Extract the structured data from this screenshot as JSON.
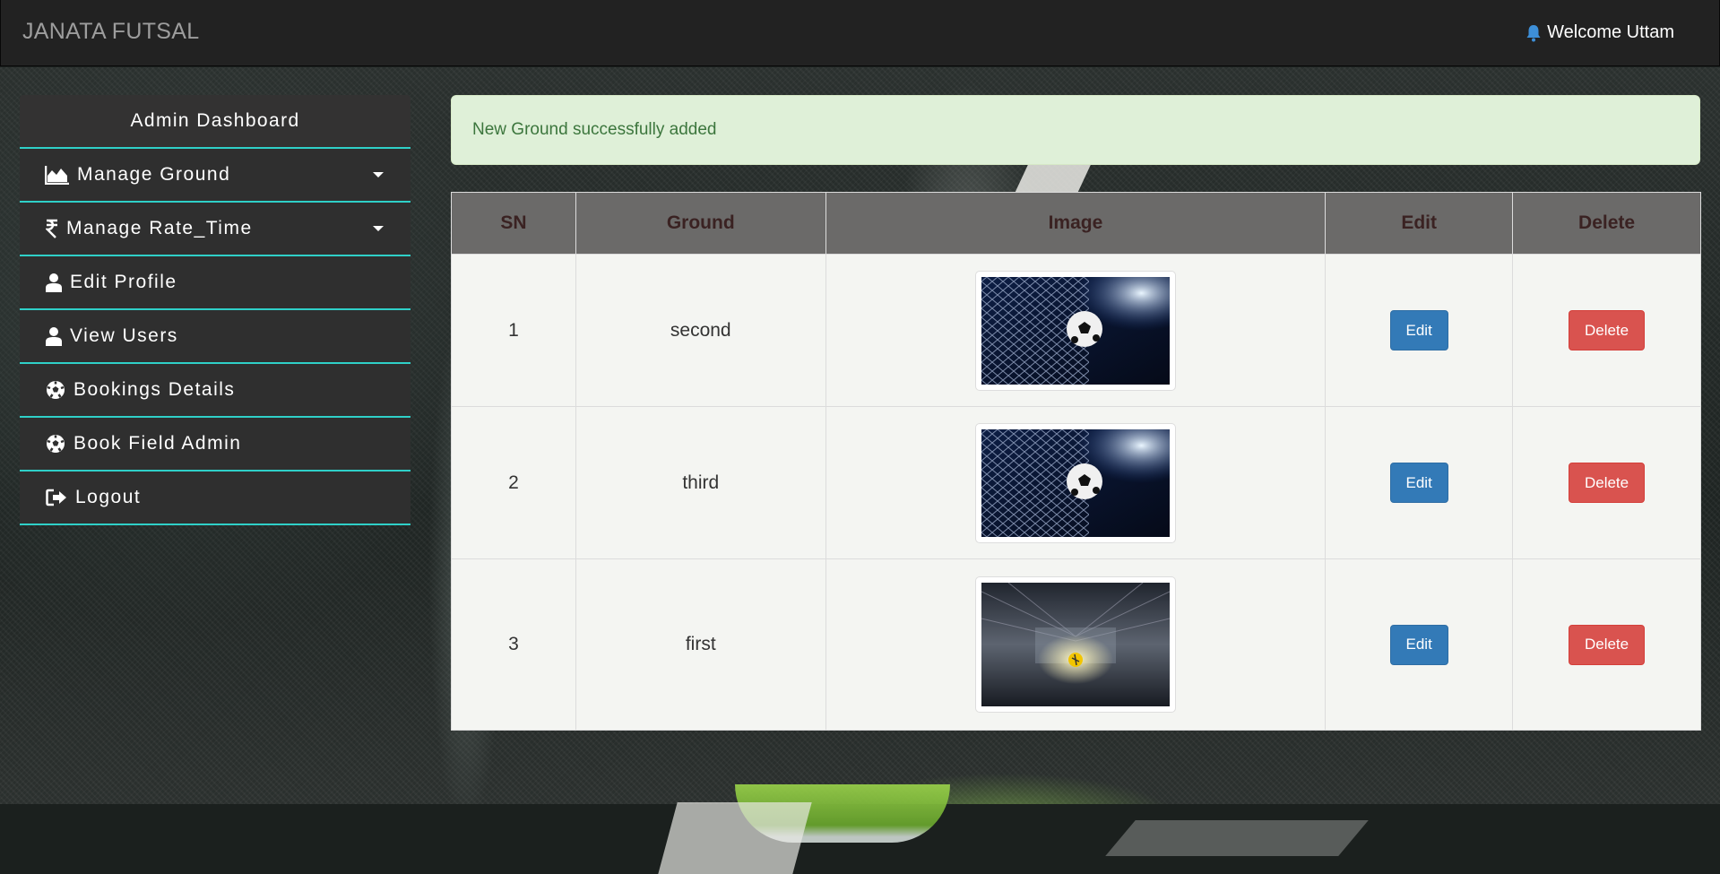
{
  "navbar": {
    "brand": "JANATA FUTSAL",
    "welcome": "Welcome Uttam"
  },
  "sidebar": {
    "header": "Admin Dashboard",
    "items": [
      {
        "label": "Manage Ground",
        "icon": "area-chart-icon",
        "dropdown": true
      },
      {
        "label": "Manage Rate_Time",
        "icon": "rupee-icon",
        "dropdown": true
      },
      {
        "label": "Edit Profile",
        "icon": "user-icon",
        "dropdown": false
      },
      {
        "label": "View Users",
        "icon": "user-icon",
        "dropdown": false
      },
      {
        "label": "Bookings Details",
        "icon": "soccer-ball-icon",
        "dropdown": false
      },
      {
        "label": "Book Field Admin",
        "icon": "soccer-ball-icon",
        "dropdown": false
      },
      {
        "label": "Logout",
        "icon": "sign-out-icon",
        "dropdown": false
      }
    ]
  },
  "alert": {
    "message": "New Ground successfully added"
  },
  "table": {
    "headers": [
      "SN",
      "Ground",
      "Image",
      "Edit",
      "Delete"
    ],
    "rows": [
      {
        "sn": "1",
        "ground": "second",
        "image": "soccer-ball-in-net",
        "edit": "Edit",
        "delete": "Delete"
      },
      {
        "sn": "2",
        "ground": "third",
        "image": "soccer-ball-in-net",
        "edit": "Edit",
        "delete": "Delete"
      },
      {
        "sn": "3",
        "ground": "first",
        "image": "ball-in-empty-hall",
        "edit": "Edit",
        "delete": "Delete"
      }
    ]
  },
  "colors": {
    "navbar": "#222222",
    "sidebar_accent": "#2fd0c8",
    "alert_bg": "#dff0d8",
    "alert_text": "#3c763d",
    "edit_button": "#337ab7",
    "delete_button": "#d9534f",
    "table_header": "#6b6a69"
  }
}
